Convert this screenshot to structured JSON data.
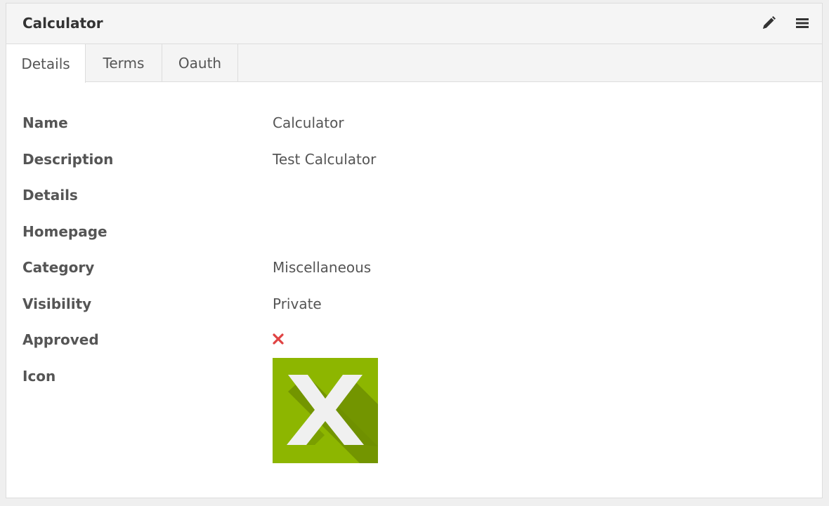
{
  "panel": {
    "title": "Calculator",
    "icons": [
      "pencil-icon",
      "menu-icon"
    ]
  },
  "tabs": [
    {
      "label": "Details",
      "active": true
    },
    {
      "label": "Terms",
      "active": false
    },
    {
      "label": "Oauth",
      "active": false
    }
  ],
  "details": {
    "name": {
      "label": "Name",
      "value": "Calculator"
    },
    "description": {
      "label": "Description",
      "value": "Test Calculator"
    },
    "details": {
      "label": "Details",
      "value": ""
    },
    "homepage": {
      "label": "Homepage",
      "value": ""
    },
    "category": {
      "label": "Category",
      "value": "Miscellaneous"
    },
    "visibility": {
      "label": "Visibility",
      "value": "Private"
    },
    "approved": {
      "label": "Approved",
      "value": false,
      "icon": "cross-icon",
      "color": "#e04343"
    },
    "icon": {
      "label": "Icon",
      "image": "app-x-icon",
      "colors": {
        "background": "#8db600",
        "shadow": "#6e8f00",
        "glyph": "#f0f0f0"
      }
    }
  }
}
